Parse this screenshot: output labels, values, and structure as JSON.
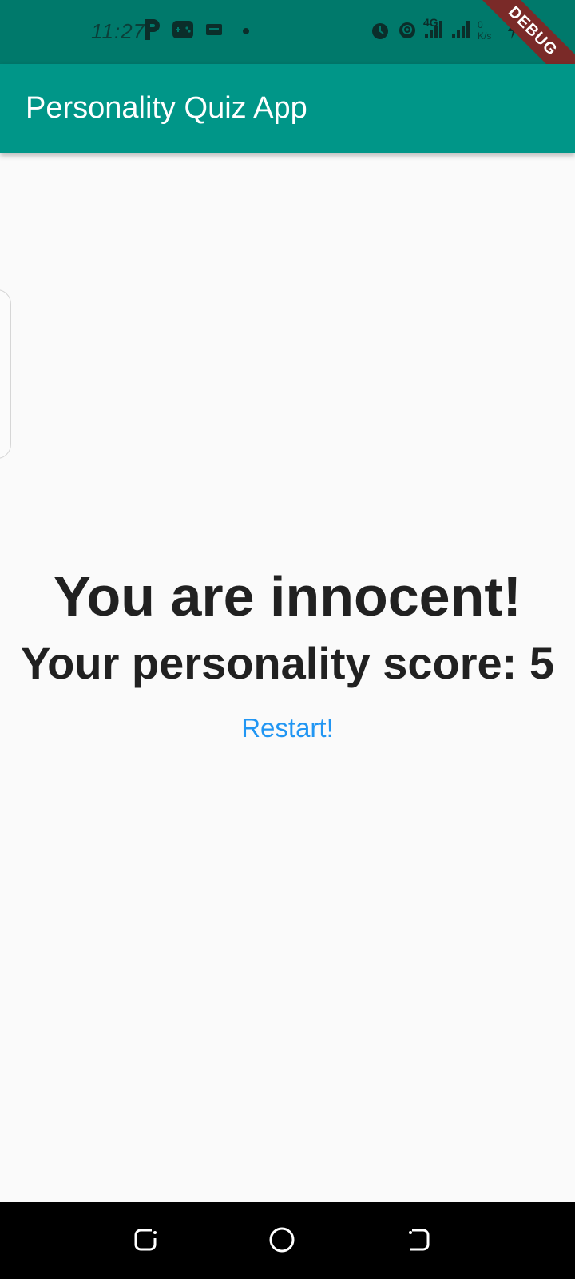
{
  "status_bar": {
    "time": "11:27",
    "network": "4G",
    "speed": "0 K/s",
    "icons": [
      "p-icon",
      "game-controller-icon",
      "message-icon",
      "dot-icon",
      "alarm-icon",
      "hotspot-icon",
      "signal-icon",
      "signal-icon-2",
      "battery-icon"
    ]
  },
  "debug_banner": "DEBUG",
  "app_bar": {
    "title": "Personality Quiz App"
  },
  "result": {
    "title": "You are innocent!",
    "score_text": "Your personality score: 5",
    "restart_label": "Restart!"
  },
  "colors": {
    "status_bar": "#00796b",
    "app_bar": "#009688",
    "accent": "#2196f3",
    "text": "#212121",
    "background": "#fafafa"
  },
  "nav": {
    "buttons": [
      "recents-icon",
      "home-icon",
      "back-icon"
    ]
  }
}
